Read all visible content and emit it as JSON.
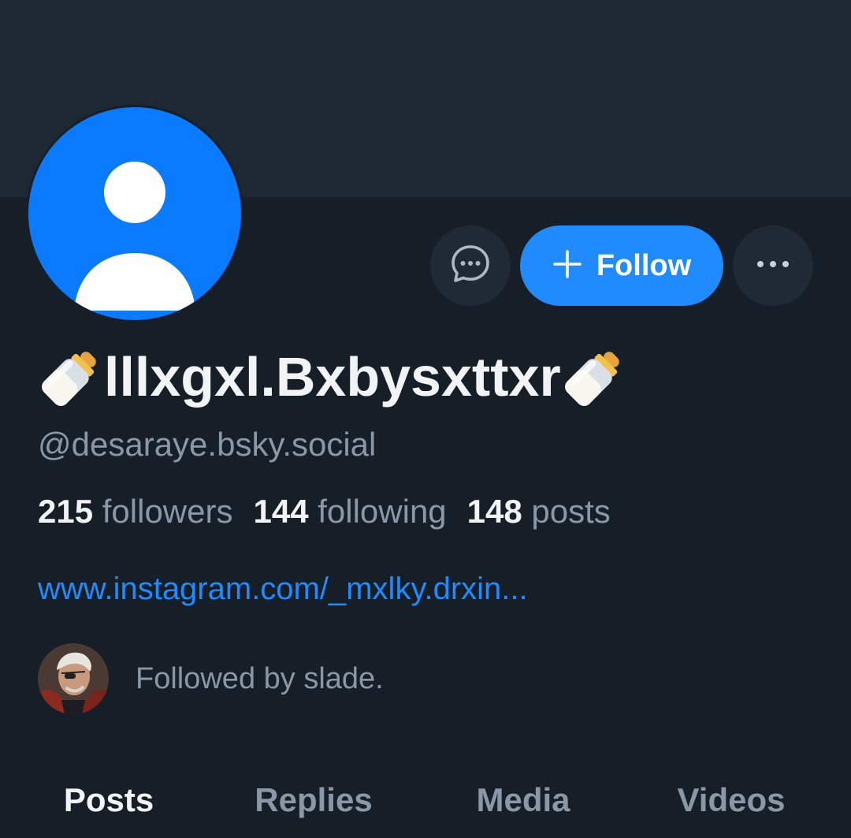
{
  "profile": {
    "display_name": "lllxgxl.Bxbysxttxr",
    "handle": "@desaraye.bsky.social",
    "link": "www.instagram.com/_mxlky.drxin...",
    "followed_by": "Followed by slade."
  },
  "stats": [
    {
      "count": "215",
      "label": "followers"
    },
    {
      "count": "144",
      "label": "following"
    },
    {
      "count": "148",
      "label": "posts"
    }
  ],
  "actions": {
    "follow_label": "Follow",
    "message_icon": "chat-bubble-icon",
    "more_icon": "ellipsis-icon"
  },
  "tabs": [
    {
      "label": "Posts",
      "active": true
    },
    {
      "label": "Replies",
      "active": false
    },
    {
      "label": "Media",
      "active": false
    },
    {
      "label": "Videos",
      "active": false
    }
  ],
  "colors": {
    "background": "#161e27",
    "banner": "#1e2833",
    "accent": "#208bfe",
    "avatar": "#0a7aff",
    "muted_text": "#8a97a6"
  },
  "icons": {
    "name_prefix": "baby-bottle-icon",
    "name_suffix": "baby-bottle-icon",
    "avatar": "default-user-avatar"
  }
}
